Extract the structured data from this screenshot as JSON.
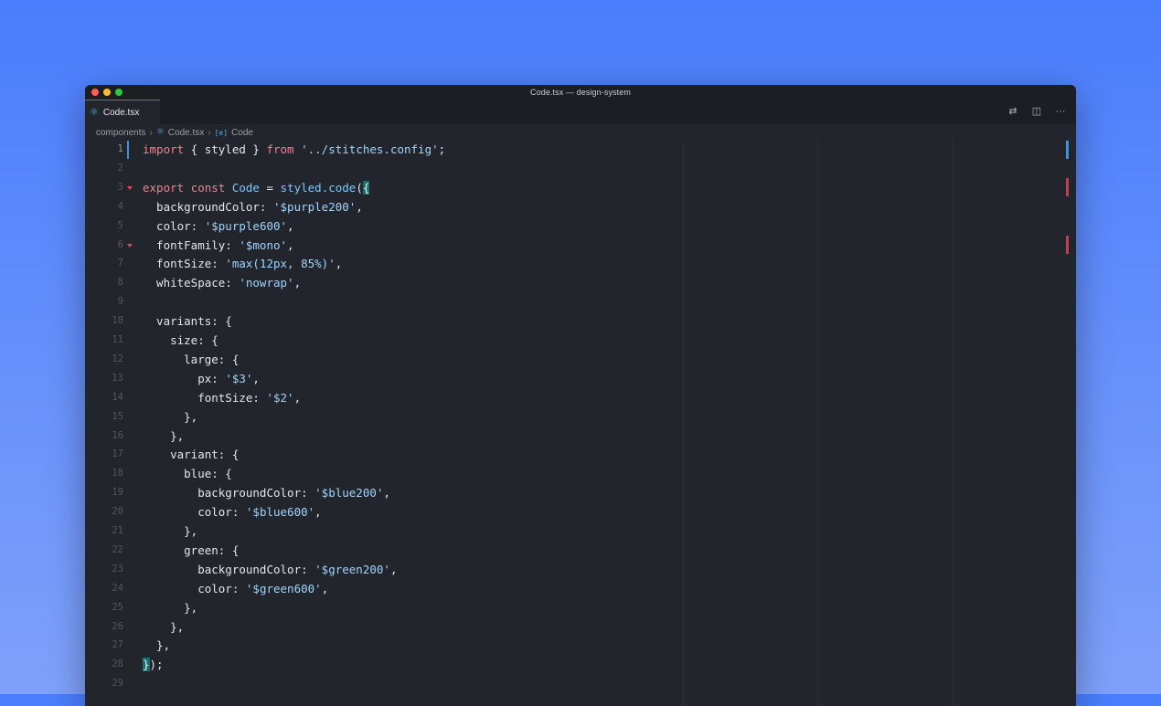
{
  "window": {
    "title": "Code.tsx — design-system"
  },
  "tab": {
    "label": "Code.tsx",
    "icon": "react-icon"
  },
  "actions": [
    {
      "name": "source-control-icon",
      "glyph": "⇄"
    },
    {
      "name": "split-editor-icon",
      "glyph": "◫"
    },
    {
      "name": "more-actions-icon",
      "glyph": "···"
    }
  ],
  "breadcrumb": {
    "folder": "components",
    "file": "Code.tsx",
    "symbol": "Code",
    "symbol_icon": "[e]"
  },
  "colors": {
    "accent": "#3f92e0",
    "keyword": "#f47f93",
    "string": "#9fd4ff",
    "function": "#7dc8ff",
    "error": "#c2414e"
  },
  "lines": [
    {
      "n": "1",
      "active": true,
      "tokens": [
        [
          "kw",
          "import"
        ],
        [
          "txt",
          " { styled } "
        ],
        [
          "kw",
          "from"
        ],
        [
          "txt",
          " "
        ],
        [
          "str",
          "'../stitches.config'"
        ],
        [
          "txt",
          ";"
        ]
      ]
    },
    {
      "n": "2",
      "tokens": []
    },
    {
      "n": "3",
      "fold": true,
      "tokens": [
        [
          "kw",
          "export"
        ],
        [
          "txt",
          " "
        ],
        [
          "kw",
          "const"
        ],
        [
          "txt",
          " "
        ],
        [
          "fn",
          "Code"
        ],
        [
          "txt",
          " = "
        ],
        [
          "fn",
          "styled.code"
        ],
        [
          "txt",
          "("
        ],
        [
          "brk",
          "{"
        ]
      ]
    },
    {
      "n": "4",
      "tokens": [
        [
          "txt",
          "  backgroundColor: "
        ],
        [
          "str",
          "'$purple200'"
        ],
        [
          "txt",
          ","
        ]
      ]
    },
    {
      "n": "5",
      "tokens": [
        [
          "txt",
          "  color: "
        ],
        [
          "str",
          "'$purple600'"
        ],
        [
          "txt",
          ","
        ]
      ]
    },
    {
      "n": "6",
      "fold": true,
      "tokens": [
        [
          "txt",
          "  fontFamily: "
        ],
        [
          "str",
          "'$mono'"
        ],
        [
          "txt",
          ","
        ]
      ]
    },
    {
      "n": "7",
      "tokens": [
        [
          "txt",
          "  fontSize: "
        ],
        [
          "str",
          "'max(12px, 85%)'"
        ],
        [
          "txt",
          ","
        ]
      ]
    },
    {
      "n": "8",
      "tokens": [
        [
          "txt",
          "  whiteSpace: "
        ],
        [
          "str",
          "'nowrap'"
        ],
        [
          "txt",
          ","
        ]
      ]
    },
    {
      "n": "9",
      "tokens": []
    },
    {
      "n": "10",
      "tokens": [
        [
          "txt",
          "  variants: {"
        ]
      ]
    },
    {
      "n": "11",
      "tokens": [
        [
          "txt",
          "    size: {"
        ]
      ]
    },
    {
      "n": "12",
      "tokens": [
        [
          "txt",
          "      large: {"
        ]
      ]
    },
    {
      "n": "13",
      "tokens": [
        [
          "txt",
          "        px: "
        ],
        [
          "str",
          "'$3'"
        ],
        [
          "txt",
          ","
        ]
      ]
    },
    {
      "n": "14",
      "tokens": [
        [
          "txt",
          "        fontSize: "
        ],
        [
          "str",
          "'$2'"
        ],
        [
          "txt",
          ","
        ]
      ]
    },
    {
      "n": "15",
      "tokens": [
        [
          "txt",
          "      },"
        ]
      ]
    },
    {
      "n": "16",
      "tokens": [
        [
          "txt",
          "    },"
        ]
      ]
    },
    {
      "n": "17",
      "tokens": [
        [
          "txt",
          "    variant: {"
        ]
      ]
    },
    {
      "n": "18",
      "tokens": [
        [
          "txt",
          "      blue: {"
        ]
      ]
    },
    {
      "n": "19",
      "tokens": [
        [
          "txt",
          "        backgroundColor: "
        ],
        [
          "str",
          "'$blue200'"
        ],
        [
          "txt",
          ","
        ]
      ]
    },
    {
      "n": "20",
      "tokens": [
        [
          "txt",
          "        color: "
        ],
        [
          "str",
          "'$blue600'"
        ],
        [
          "txt",
          ","
        ]
      ]
    },
    {
      "n": "21",
      "tokens": [
        [
          "txt",
          "      },"
        ]
      ]
    },
    {
      "n": "22",
      "tokens": [
        [
          "txt",
          "      green: {"
        ]
      ]
    },
    {
      "n": "23",
      "tokens": [
        [
          "txt",
          "        backgroundColor: "
        ],
        [
          "str",
          "'$green200'"
        ],
        [
          "txt",
          ","
        ]
      ]
    },
    {
      "n": "24",
      "tokens": [
        [
          "txt",
          "        color: "
        ],
        [
          "str",
          "'$green600'"
        ],
        [
          "txt",
          ","
        ]
      ]
    },
    {
      "n": "25",
      "tokens": [
        [
          "txt",
          "      },"
        ]
      ]
    },
    {
      "n": "26",
      "tokens": [
        [
          "txt",
          "    },"
        ]
      ]
    },
    {
      "n": "27",
      "tokens": [
        [
          "txt",
          "  },"
        ]
      ]
    },
    {
      "n": "28",
      "tokens": [
        [
          "brk",
          "}"
        ],
        [
          "txt",
          ");"
        ]
      ]
    },
    {
      "n": "29",
      "tokens": []
    }
  ]
}
